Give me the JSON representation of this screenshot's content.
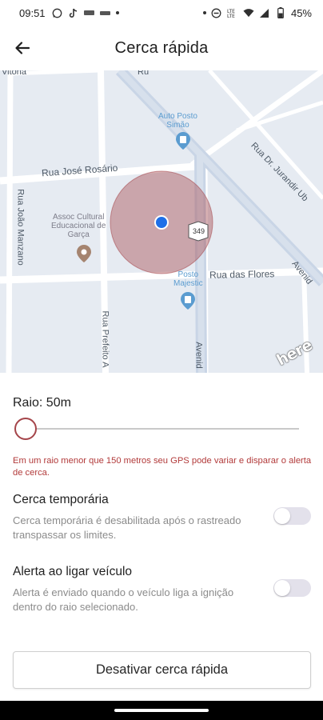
{
  "status_bar": {
    "time": "09:51",
    "battery": "45%",
    "left_icons": [
      "whatsapp-icon",
      "tiktok-icon",
      "notification-icon",
      "notification-icon",
      "dot-icon"
    ],
    "right_icons": [
      "dot-icon",
      "dnd-icon",
      "lte-icon",
      "wifi-icon",
      "signal-icon",
      "battery-icon"
    ]
  },
  "app_bar": {
    "title": "Cerca rápida",
    "back_icon": "arrow-left-icon"
  },
  "map": {
    "labels": {
      "top_left_road": "Vitória",
      "top_road": "Ru",
      "auto_posto": "Auto Posto\nSimão",
      "rua_jose_rosario": "Rua José Rosário",
      "rua_joao_manzano": "Rua João Manzano",
      "assoc_cultural": "Assoc Cultural\nEducacional de\nGarça",
      "rua_dr_jurandir": "Rua Dr. Jurandir Ub",
      "route_shield": "349",
      "posto_majestic": "Posto\nMajestic",
      "rua_das_flores": "Rua das Flores",
      "rua_prefeito": "Rua Prefeito A",
      "avenida_bottom": "Avenid",
      "avenida_right": "Avenid",
      "brand": "here"
    },
    "geofence_color": "#a5454a",
    "location_color": "#1d6fe8"
  },
  "radius": {
    "label": "Raio: 50m",
    "value_m": 50,
    "warning": "Em um raio menor que 150 metros seu GPS pode variar e disparar o alerta de cerca."
  },
  "settings": [
    {
      "title": "Cerca temporária",
      "description": "Cerca temporária é desabilitada após o rastreado transpassar os limites.",
      "enabled": false
    },
    {
      "title": "Alerta ao ligar veículo",
      "description": "Alerta é enviado quando o veículo liga a ignição dentro do raio selecionado.",
      "enabled": false
    }
  ],
  "action_button": {
    "label": "Desativar cerca rápida"
  },
  "colors": {
    "accent": "#a5454a",
    "warning_text": "#b23a3a",
    "toggle_off_track": "#e3e1eb"
  }
}
